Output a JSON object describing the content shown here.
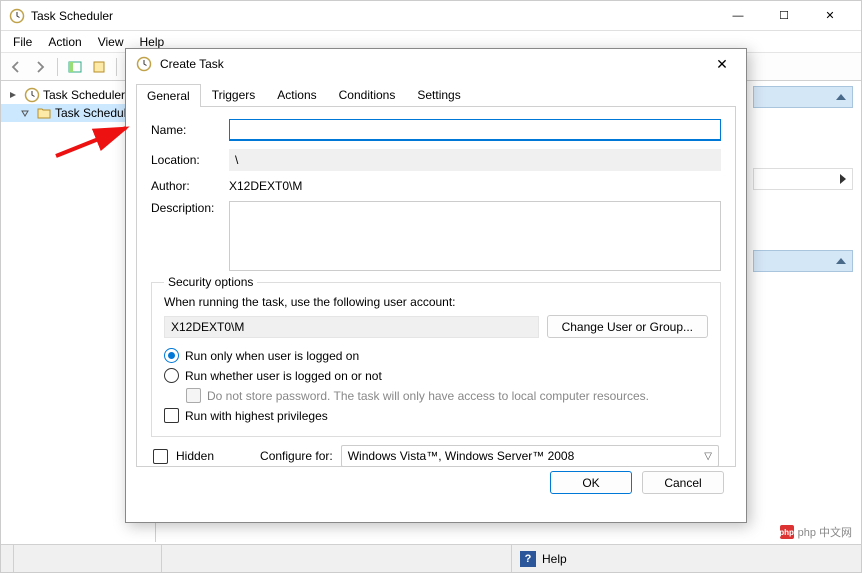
{
  "window": {
    "title": "Task Scheduler",
    "controls": {
      "min": "—",
      "max": "☐",
      "close": "✕"
    }
  },
  "menu": {
    "file": "File",
    "action": "Action",
    "view": "View",
    "help": "Help"
  },
  "tree": {
    "root": "Task Scheduler (L",
    "child": "Task Schedule"
  },
  "dialog": {
    "title": "Create Task",
    "close": "✕",
    "tabs": {
      "general": "General",
      "triggers": "Triggers",
      "actions": "Actions",
      "conditions": "Conditions",
      "settings": "Settings"
    },
    "general": {
      "name_label": "Name:",
      "name_value": "",
      "location_label": "Location:",
      "location_value": "\\",
      "author_label": "Author:",
      "author_value": "X12DEXT0\\M",
      "description_label": "Description:",
      "description_value": "",
      "security_legend": "Security options",
      "security_prompt": "When running the task, use the following user account:",
      "security_user": "X12DEXT0\\M",
      "change_user_btn": "Change User or Group...",
      "radio_logged_on": "Run only when user is logged on",
      "radio_not_logged": "Run whether user is logged on or not",
      "no_store_pw": "Do not store password.  The task will only have access to local computer resources.",
      "highest_priv": "Run with highest privileges",
      "hidden_label": "Hidden",
      "configure_label": "Configure for:",
      "configure_value": "Windows Vista™, Windows Server™ 2008"
    },
    "buttons": {
      "ok": "OK",
      "cancel": "Cancel"
    }
  },
  "statusbar": {
    "help": "Help"
  },
  "watermark": "php 中文网"
}
